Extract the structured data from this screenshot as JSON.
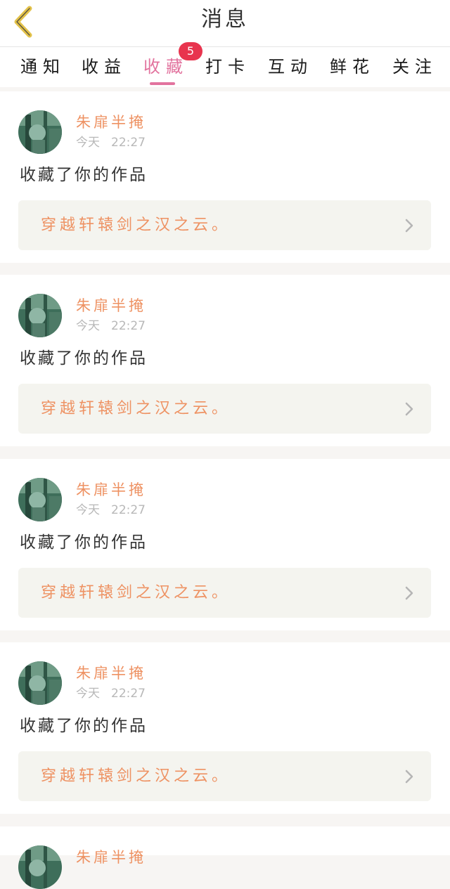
{
  "header": {
    "title": "消息",
    "back_icon": "chevron-left-icon",
    "back_color": "#e3c24a"
  },
  "tabs": [
    {
      "label": "通知",
      "active": false
    },
    {
      "label": "收益",
      "active": false
    },
    {
      "label": "收藏",
      "active": true
    },
    {
      "label": "打卡",
      "active": false
    },
    {
      "label": "互动",
      "active": false
    },
    {
      "label": "鲜花",
      "active": false
    },
    {
      "label": "关注",
      "active": false
    }
  ],
  "badge": {
    "count": "5",
    "color": "#e8344e"
  },
  "colors": {
    "accent": "#e2739e",
    "username": "#ee9263",
    "work_bg": "#f4f4ef",
    "page_bg": "#f7f5f3"
  },
  "notifications": [
    {
      "user": "朱扉半掩",
      "date": "今天",
      "time": "22:27",
      "action": "收藏了你的作品",
      "work": "穿越轩辕剑之汉之云。"
    },
    {
      "user": "朱扉半掩",
      "date": "今天",
      "time": "22:27",
      "action": "收藏了你的作品",
      "work": "穿越轩辕剑之汉之云。"
    },
    {
      "user": "朱扉半掩",
      "date": "今天",
      "time": "22:27",
      "action": "收藏了你的作品",
      "work": "穿越轩辕剑之汉之云。"
    },
    {
      "user": "朱扉半掩",
      "date": "今天",
      "time": "22:27",
      "action": "收藏了你的作品",
      "work": "穿越轩辕剑之汉之云。"
    },
    {
      "user": "朱扉半掩",
      "date": "",
      "time": "",
      "action": "",
      "work": ""
    }
  ]
}
